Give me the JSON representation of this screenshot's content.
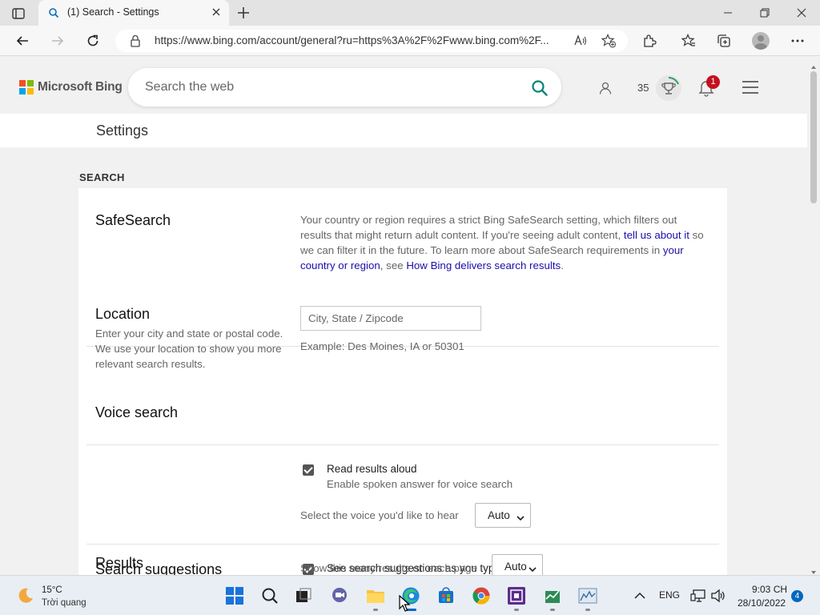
{
  "browser": {
    "tab_title": "(1) Search - Settings",
    "url": "https://www.bing.com/account/general?ru=https%3A%2F%2Fwww.bing.com%2F..."
  },
  "header": {
    "logo_text": "Microsoft Bing",
    "search_placeholder": "Search the web",
    "points": "35",
    "notification_count": "1"
  },
  "settings_title": "Settings",
  "section_title": "SEARCH",
  "safesearch": {
    "label": "SafeSearch",
    "text1": "Your country or region requires a strict Bing SafeSearch setting, which filters out results that might return adult content. If you're seeing adult content, ",
    "link1": "tell us about it",
    "text2": " so we can filter it in the future. To learn more about SafeSearch requirements in ",
    "link2": "your country or region",
    "text3": ", see ",
    "link3": "How Bing delivers search results",
    "text4": "."
  },
  "location": {
    "label": "Location",
    "description": "Enter your city and state or postal code. We use your location to show you more relevant search results.",
    "placeholder": "City, State / Zipcode",
    "example": "Example: Des Moines, IA or 50301"
  },
  "voice": {
    "label": "Voice search",
    "checkbox_label": "Read results aloud",
    "checkbox_sub": "Enable spoken answer for voice search",
    "select_label": "Select the voice you'd like to hear",
    "select_value": "Auto"
  },
  "suggestions": {
    "label": "Search suggestions",
    "checkbox_label": "See search suggestions as you type"
  },
  "results": {
    "label": "Results",
    "select_label": "Show this many results on each page",
    "select_value": "Auto"
  },
  "taskbar": {
    "temperature": "15°C",
    "weather": "Trời quang",
    "language": "ENG",
    "time": "9:03 CH",
    "date": "28/10/2022",
    "notifications": "4"
  },
  "colors": {
    "link": "#1a0dab",
    "search_icon": "#008373",
    "badge": "#c50f1f"
  }
}
